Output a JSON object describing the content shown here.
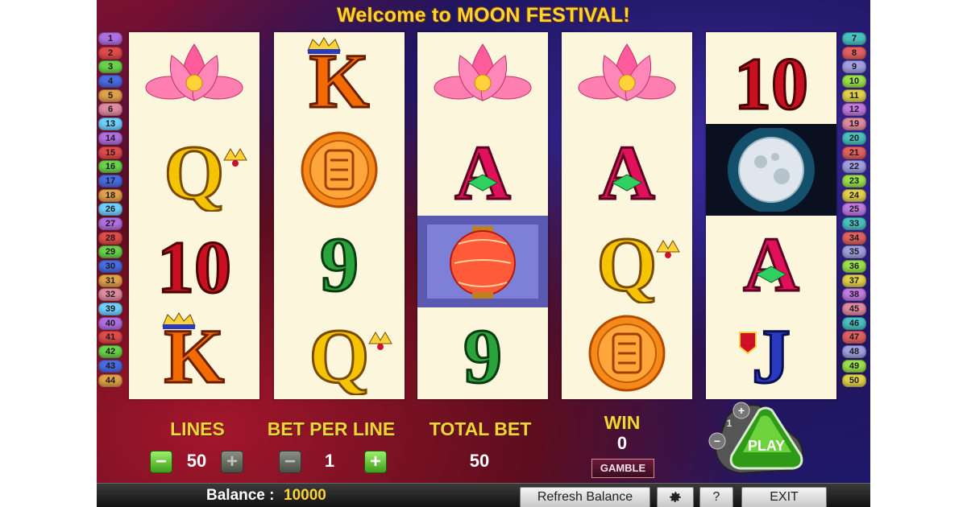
{
  "title": "Welcome to MOON FESTIVAL!",
  "lines_left": [
    "1",
    "2",
    "3",
    "4",
    "5",
    "6",
    "13",
    "14",
    "15",
    "16",
    "17",
    "18",
    "26",
    "27",
    "28",
    "29",
    "30",
    "31",
    "32",
    "39",
    "40",
    "41",
    "42",
    "43",
    "44"
  ],
  "lines_right": [
    "7",
    "8",
    "9",
    "10",
    "11",
    "12",
    "19",
    "20",
    "21",
    "22",
    "23",
    "24",
    "25",
    "33",
    "34",
    "35",
    "36",
    "37",
    "38",
    "45",
    "46",
    "47",
    "48",
    "49",
    "50"
  ],
  "reels": [
    [
      "lotus",
      "Q",
      "10",
      "K"
    ],
    [
      "K",
      "mooncake",
      "9",
      "Q"
    ],
    [
      "lotus",
      "A",
      "lantern",
      "9"
    ],
    [
      "lotus",
      "A",
      "Q",
      "mooncake"
    ],
    [
      "10",
      "moon",
      "A",
      "J"
    ]
  ],
  "controls": {
    "lines_label": "LINES",
    "lines_value": "50",
    "bet_label": "BET PER LINE",
    "bet_value": "1",
    "total_label": "TOTAL BET",
    "total_value": "50",
    "win_label": "WIN",
    "win_value": "0",
    "gamble": "GAMBLE",
    "play": "PLAY",
    "minus": "−",
    "plus": "+",
    "auto_count": "1"
  },
  "bottom": {
    "balance_label": "Balance :",
    "balance_value": "10000",
    "refresh": "Refresh Balance",
    "help": "?",
    "exit": "EXIT"
  },
  "icons": {
    "settings": "gear-icon"
  }
}
